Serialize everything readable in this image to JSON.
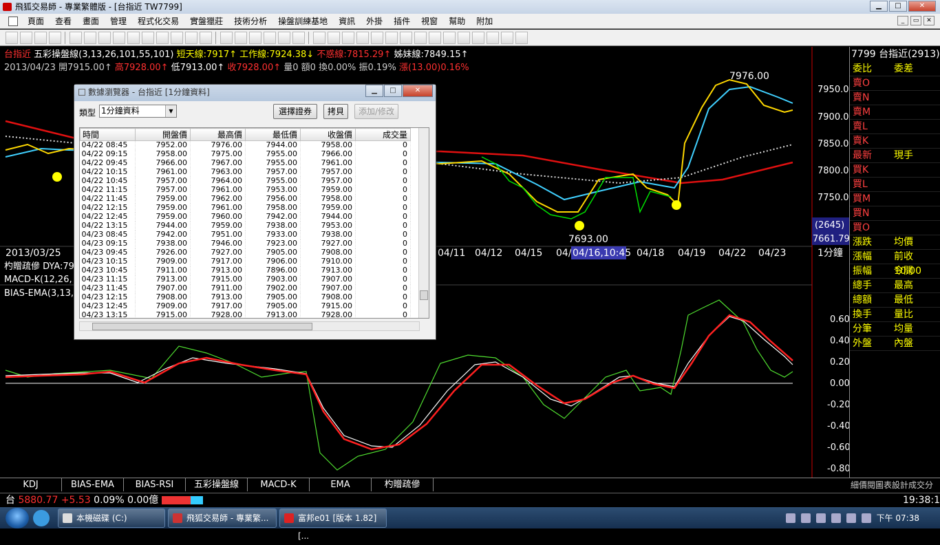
{
  "window": {
    "title": "飛狐交易師 - 專業繁體版 - [台指近 TW7799]",
    "min": "▁",
    "max": "□",
    "close": "✕"
  },
  "menu": [
    "頁面",
    "查看",
    "畫面",
    "管理",
    "程式化交易",
    "實盤獵莊",
    "技術分析",
    "操盤訓練基地",
    "資訊",
    "外掛",
    "插件",
    "視窗",
    "幫助",
    "附加"
  ],
  "mdi": {
    "min": "_",
    "restore": "▭",
    "close": "✕"
  },
  "info": {
    "line1": {
      "name": "台指近",
      "indicator": "五彩操盤線(3,13,26,101,55,101)",
      "short": "短天線:7917↑",
      "work": "工作線:7924.38↓",
      "nomove": "不惑線:7815.29↑",
      "sister": "姊妹線:7849.15↑"
    },
    "line2": {
      "date": "2013/04/23",
      "open": "開7915.00↑",
      "high": "高7928.00↑",
      "low": "低7913.00↑",
      "close": "收7928.00↑",
      "vol": "量0 額0 換0.00% 振0.19%",
      "change": "漲(13.00)0.16%"
    }
  },
  "chart_labels": {
    "peak": "7976.00",
    "trough": "7693.00",
    "left_date": "2013/03/25",
    "left_price": "(2645)",
    "right_price": "7661.79",
    "period": "1分鐘",
    "ind1": "杓贈疏傪 DYA:79",
    "ind2": "MACD-K(12,26,",
    "ind3": "BIAS-EMA(3,13,",
    "x_dates": [
      "04/11",
      "04/12",
      "04/15",
      "04/",
      "04/16,10:45",
      "04/18",
      "04/19",
      "04/22",
      "04/23"
    ],
    "y_ticks": [
      "7950.0",
      "7900.0",
      "7850.0",
      "7800.0",
      "7750.0"
    ],
    "y2_ticks": [
      "0.60",
      "0.40",
      "0.20",
      "0.00",
      "-0.20",
      "-0.40",
      "-0.60",
      "-0.80"
    ]
  },
  "rightpanel": {
    "header_code": "7799",
    "header_name": "台指近",
    "header_count": "(2913)",
    "row1": [
      "委比",
      "委差"
    ],
    "asks": [
      "賣O",
      "賣N",
      "賣M",
      "賣L",
      "賣K"
    ],
    "row_latest": [
      "最新",
      "現手"
    ],
    "bids": [
      "買K",
      "買L",
      "買M",
      "買N",
      "買O"
    ],
    "stats": [
      [
        "漲跌",
        "均價"
      ],
      [
        "漲幅",
        "前收10.00"
      ],
      [
        "振幅",
        "今開"
      ],
      [
        "總手",
        "最高"
      ],
      [
        "總額",
        "最低"
      ],
      [
        "換手",
        "量比"
      ],
      [
        "分筆",
        "均量"
      ],
      [
        "外盤",
        "內盤"
      ]
    ]
  },
  "tabs": [
    "KDJ",
    "BIAS-EMA",
    "BIAS-RSI",
    "五彩操盤線",
    "MACD-K",
    "EMA",
    "杓贈疏傪"
  ],
  "tab_right": "細價閱圖表設計成交分價",
  "status": {
    "label": "台",
    "value": "5880.77",
    "change": "+5.53",
    "pct": "0.09%",
    "amount": "0.00億",
    "time": "19:38:11"
  },
  "taskbar": {
    "items": [
      "本機磁碟 (C:)",
      "飛狐交易師 - 專業繁...",
      "富邦e01 [版本 1.82][..."
    ],
    "clock": "下午 07:38"
  },
  "dialog": {
    "title": "數據瀏覽器 - 台指近 [1分鐘資料]",
    "type_label": "類型",
    "type_value": "1分鐘資料",
    "btn_select": "選擇證券",
    "btn_copy": "拷貝",
    "btn_add": "添加/修改",
    "columns": [
      "時間",
      "開盤價",
      "最高價",
      "最低價",
      "收盤價",
      "成交量"
    ],
    "rows": [
      [
        "04/22 08:45",
        "7952.00",
        "7976.00",
        "7944.00",
        "7958.00",
        "0"
      ],
      [
        "04/22 09:15",
        "7958.00",
        "7975.00",
        "7955.00",
        "7966.00",
        "0"
      ],
      [
        "04/22 09:45",
        "7966.00",
        "7967.00",
        "7955.00",
        "7961.00",
        "0"
      ],
      [
        "04/22 10:15",
        "7961.00",
        "7963.00",
        "7957.00",
        "7957.00",
        "0"
      ],
      [
        "04/22 10:45",
        "7957.00",
        "7964.00",
        "7955.00",
        "7957.00",
        "0"
      ],
      [
        "04/22 11:15",
        "7957.00",
        "7961.00",
        "7953.00",
        "7959.00",
        "0"
      ],
      [
        "04/22 11:45",
        "7959.00",
        "7962.00",
        "7956.00",
        "7958.00",
        "0"
      ],
      [
        "04/22 12:15",
        "7959.00",
        "7961.00",
        "7958.00",
        "7959.00",
        "0"
      ],
      [
        "04/22 12:45",
        "7959.00",
        "7960.00",
        "7942.00",
        "7944.00",
        "0"
      ],
      [
        "04/22 13:15",
        "7944.00",
        "7959.00",
        "7938.00",
        "7953.00",
        "0"
      ],
      [
        "04/23 08:45",
        "7942.00",
        "7951.00",
        "7933.00",
        "7938.00",
        "0"
      ],
      [
        "04/23 09:15",
        "7938.00",
        "7946.00",
        "7923.00",
        "7927.00",
        "0"
      ],
      [
        "04/23 09:45",
        "7926.00",
        "7927.00",
        "7905.00",
        "7908.00",
        "0"
      ],
      [
        "04/23 10:15",
        "7909.00",
        "7917.00",
        "7906.00",
        "7910.00",
        "0"
      ],
      [
        "04/23 10:45",
        "7911.00",
        "7913.00",
        "7896.00",
        "7913.00",
        "0"
      ],
      [
        "04/23 11:15",
        "7913.00",
        "7915.00",
        "7903.00",
        "7907.00",
        "0"
      ],
      [
        "04/23 11:45",
        "7907.00",
        "7911.00",
        "7902.00",
        "7907.00",
        "0"
      ],
      [
        "04/23 12:15",
        "7908.00",
        "7913.00",
        "7905.00",
        "7908.00",
        "0"
      ],
      [
        "04/23 12:45",
        "7909.00",
        "7917.00",
        "7905.00",
        "7915.00",
        "0"
      ],
      [
        "04/23 13:15",
        "7915.00",
        "7928.00",
        "7913.00",
        "7928.00",
        "0"
      ]
    ]
  },
  "colors": {
    "up": "#ff3030",
    "down": "#00ff00",
    "accent": "#ffff00",
    "cyan": "#60e0ff"
  }
}
